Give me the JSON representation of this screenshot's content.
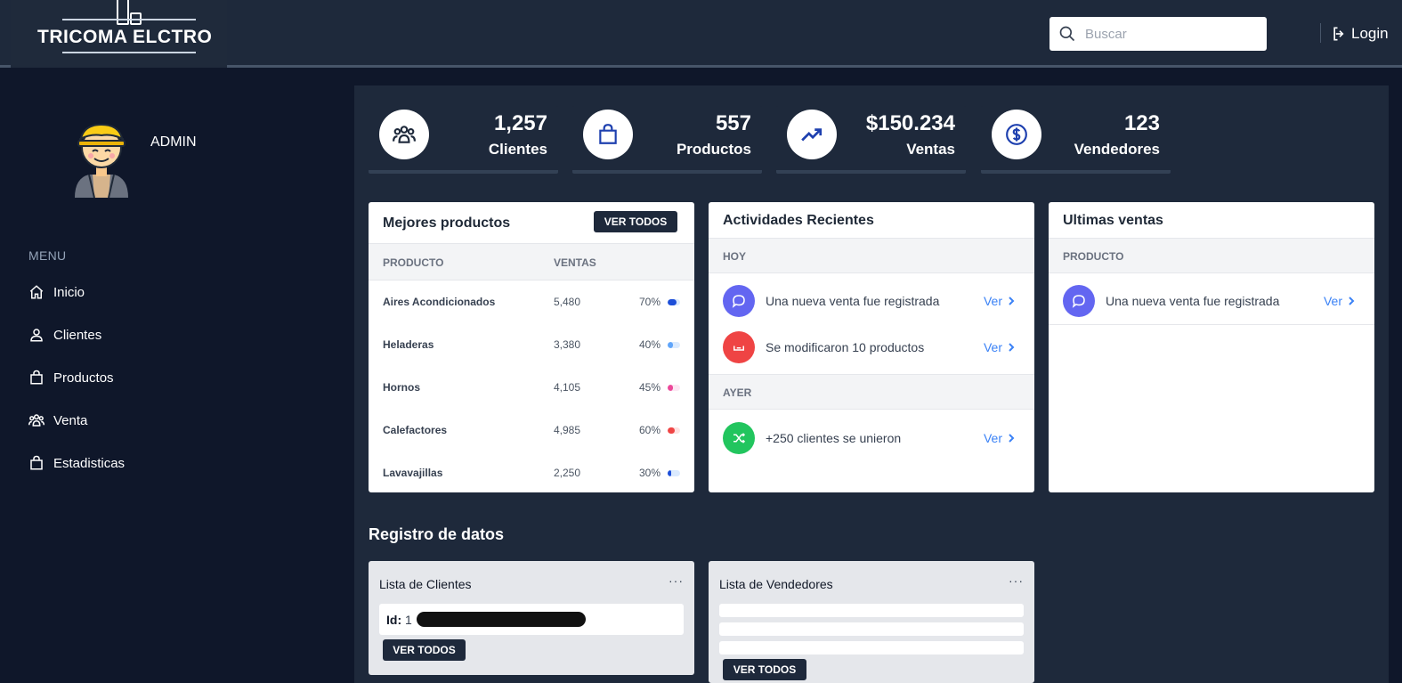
{
  "header": {
    "brand": "TRICOMA ELCTRO",
    "search_placeholder": "Buscar",
    "login_label": "Login"
  },
  "sidebar": {
    "user_name": "ADMIN",
    "menu_title": "MENU",
    "items": [
      {
        "label": "Inicio",
        "icon": "home-icon"
      },
      {
        "label": "Clientes",
        "icon": "user-icon"
      },
      {
        "label": "Productos",
        "icon": "shopping-bag-icon"
      },
      {
        "label": "Venta",
        "icon": "users-icon"
      },
      {
        "label": "Estadisticas",
        "icon": "shopping-bag-icon"
      }
    ]
  },
  "stats": [
    {
      "value": "1,257",
      "label": "Clientes",
      "icon": "users-icon"
    },
    {
      "value": "557",
      "label": "Productos",
      "icon": "shopping-bag-icon"
    },
    {
      "value": "$150.234",
      "label": "Ventas",
      "icon": "trending-up-icon"
    },
    {
      "value": "123",
      "label": "Vendedores",
      "icon": "dollar-icon"
    }
  ],
  "best_products": {
    "title": "Mejores productos",
    "button": "VER TODOS",
    "col_product": "PRODUCTO",
    "col_sales": "VENTAS",
    "rows": [
      {
        "name": "Aires Acondicionados",
        "sales": "5,480",
        "pct": "70%",
        "fraction": 0.7,
        "color": "#1d4ed8"
      },
      {
        "name": "Heladeras",
        "sales": "3,380",
        "pct": "40%",
        "fraction": 0.4,
        "color": "#60a5fa"
      },
      {
        "name": "Hornos",
        "sales": "4,105",
        "pct": "45%",
        "fraction": 0.45,
        "color": "#ec4899"
      },
      {
        "name": "Calefactores",
        "sales": "4,985",
        "pct": "60%",
        "fraction": 0.6,
        "color": "#ef4444"
      },
      {
        "name": "Lavavajillas",
        "sales": "2,250",
        "pct": "30%",
        "fraction": 0.3,
        "color": "#1d4ed8"
      }
    ]
  },
  "activities": {
    "title": "Actividades Recientes",
    "today": "HOY",
    "yesterday": "AYER",
    "link": "Ver",
    "items": [
      {
        "text": "Una nueva venta fue registrada",
        "color": "#6366f1",
        "icon": "chat-bubble-icon"
      },
      {
        "text": "Se modificaron 10 productos",
        "color": "#ef4444",
        "icon": "inbox-icon"
      },
      {
        "text": "+250 clientes se unieron",
        "color": "#22c55e",
        "icon": "shuffle-icon"
      }
    ]
  },
  "last_sales": {
    "title": "Ultimas ventas",
    "col_product": "PRODUCTO",
    "link": "Ver",
    "items": [
      {
        "text": "Una nueva venta fue registrada",
        "color": "#6366f1",
        "icon": "chat-bubble-icon"
      }
    ]
  },
  "registry": {
    "title": "Registro de datos",
    "clients": {
      "title": "Lista de Clientes",
      "id_label": "Id:",
      "id_value": "1",
      "button": "VER TODOS",
      "menu": "···"
    },
    "sellers": {
      "title": "Lista de Vendedores",
      "button": "VER TODOS",
      "menu": "···"
    }
  }
}
